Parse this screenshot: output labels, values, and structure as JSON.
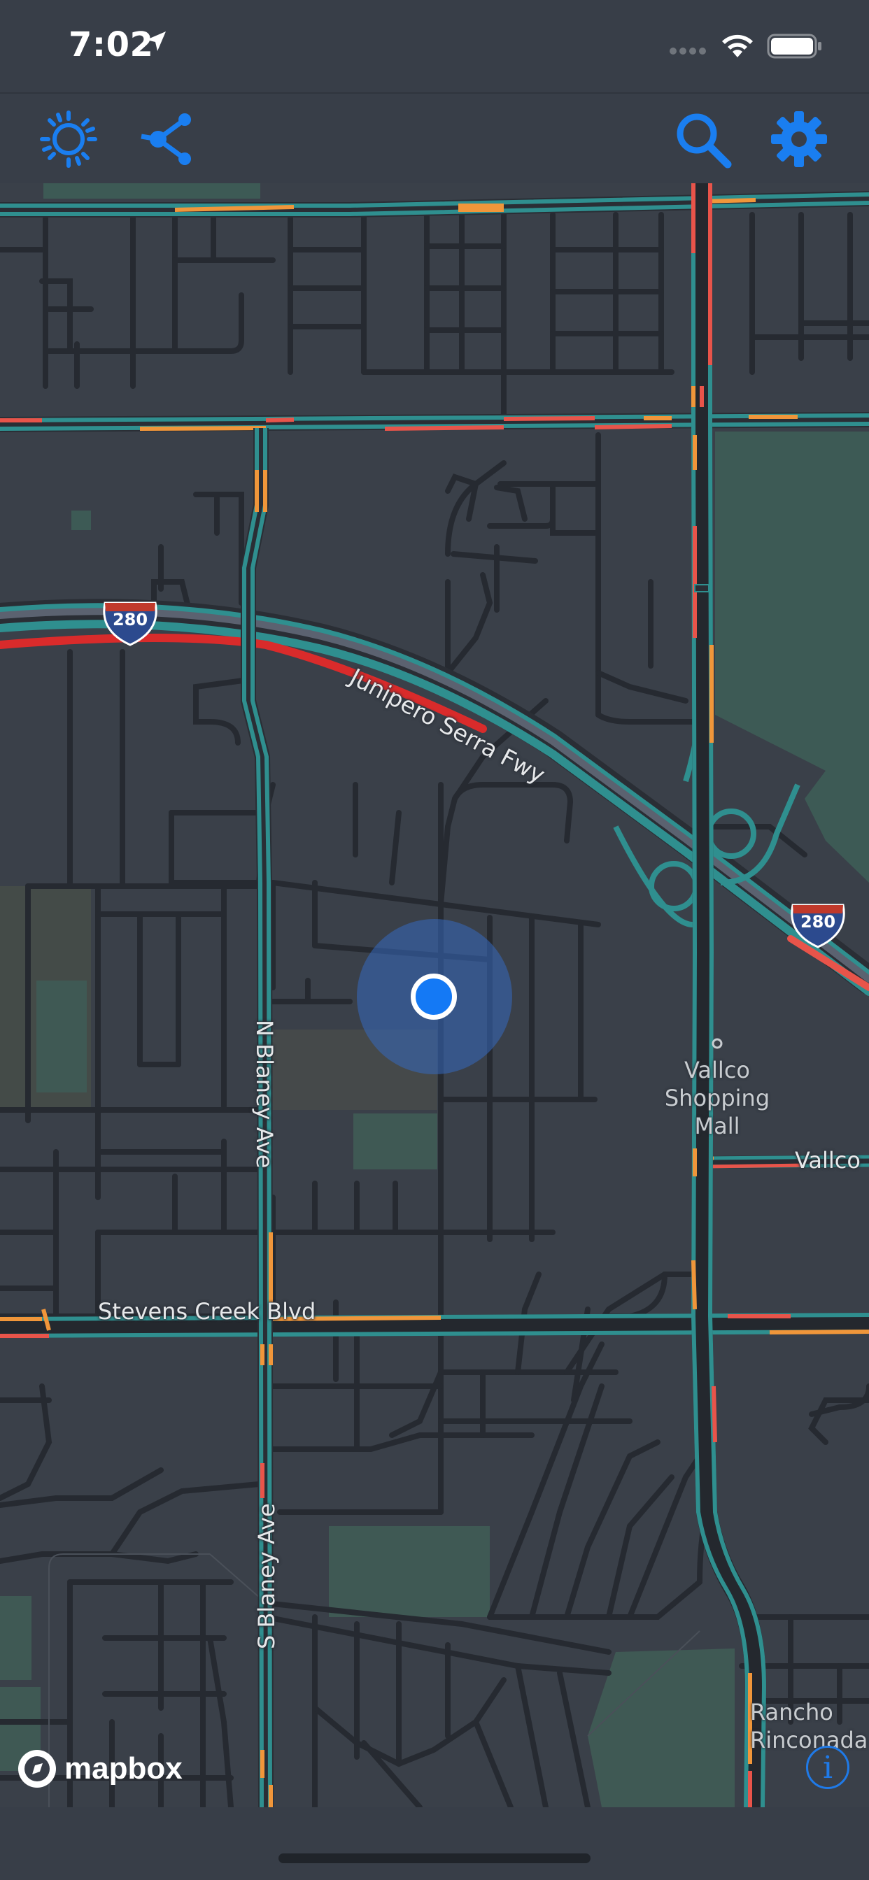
{
  "status_bar": {
    "time": "7:02",
    "icons": [
      "location-arrow-icon",
      "signal-dots-icon",
      "wifi-icon",
      "battery-icon"
    ]
  },
  "toolbar": {
    "left_buttons": [
      "brightness-icon",
      "share-nodes-icon"
    ],
    "right_buttons": [
      "search-icon",
      "gear-icon"
    ],
    "accent_color": "#1a7ef0"
  },
  "map": {
    "road_labels": {
      "freeway": "Junipero Serra Fwy",
      "n_blaney": "N Blaney Ave",
      "s_blaney": "S Blaney Ave",
      "stevens_creek": "Stevens Creek Blvd",
      "vallco_road": "Vallco"
    },
    "shields": {
      "west": "280",
      "east": "280"
    },
    "poi_labels": {
      "vallco_mall": "Vallco\nShopping\nMall",
      "rancho": "Rancho\nRinconada"
    },
    "traffic_colors": {
      "free_flow": "#2f8f8f",
      "moderate": "#f0963a",
      "heavy": "#e8544a",
      "severe": "#d92b2b"
    },
    "attribution": {
      "logo_text": "mapbox"
    }
  }
}
